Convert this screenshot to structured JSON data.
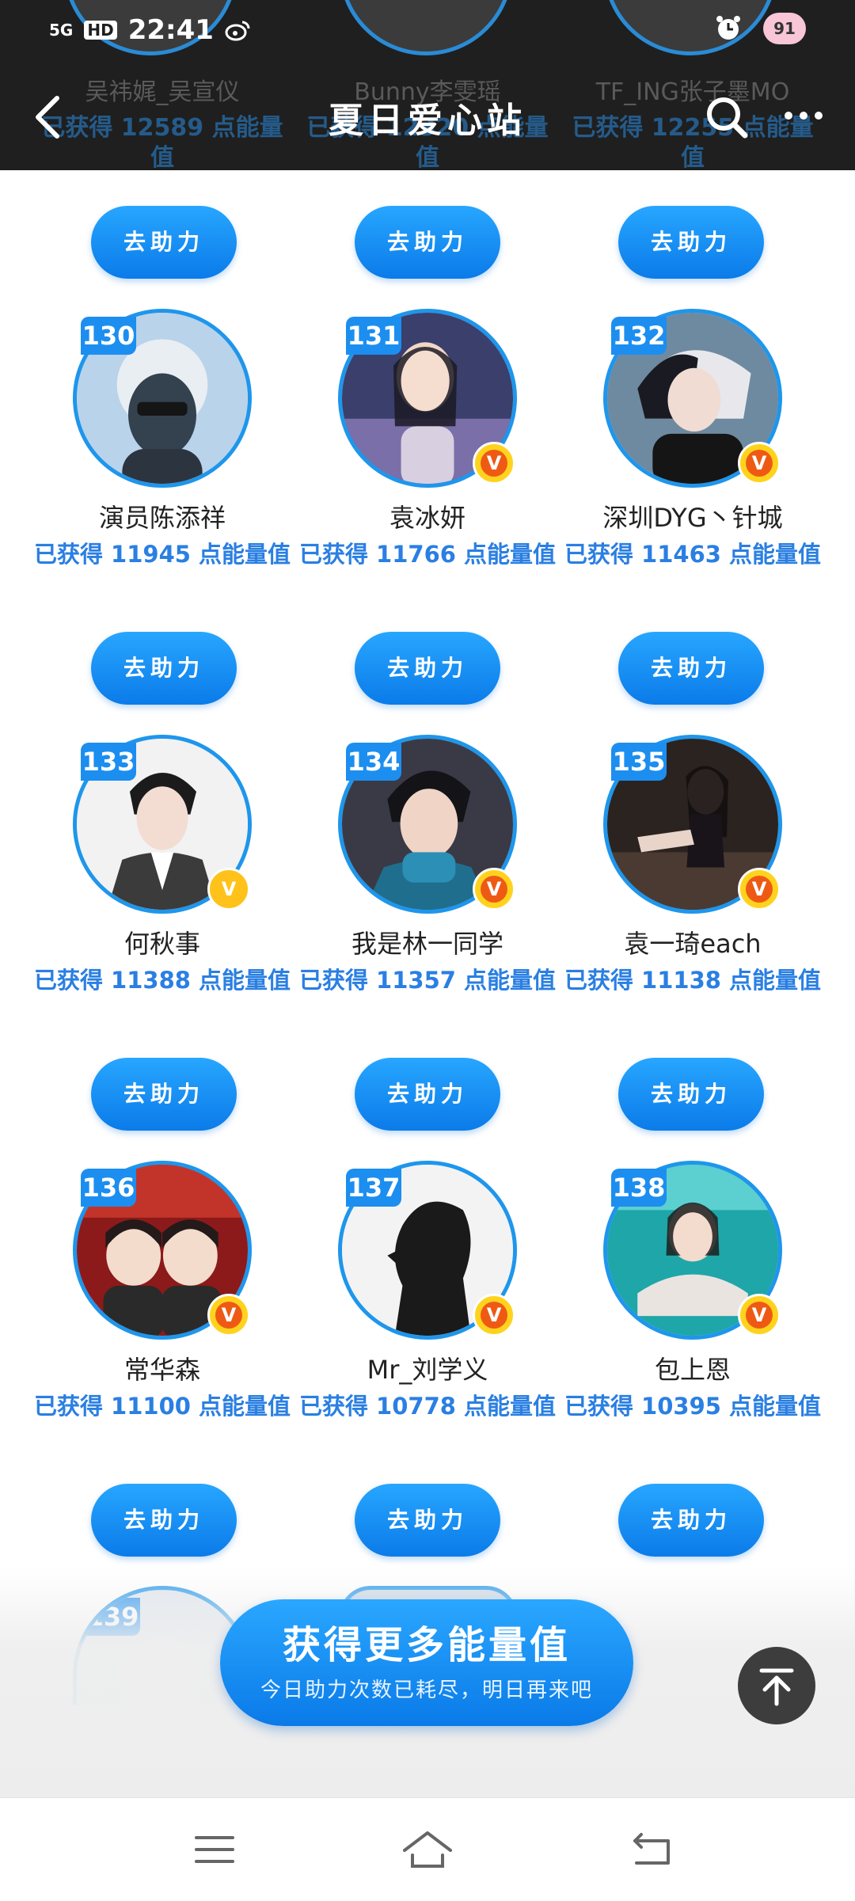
{
  "status_bar": {
    "network": "5G",
    "hd": "HD",
    "time": "22:41",
    "battery": "91"
  },
  "header": {
    "title": "夏日爱心站",
    "back_icon": "chevron-left-icon",
    "search_icon": "search-icon",
    "more_icon": "more-dots-icon"
  },
  "partial_top_row": [
    {
      "name": "吴祎娓_吴宣仪",
      "score_text": "已获得 12589 点能量值"
    },
    {
      "name": "Bunny李雯瑶",
      "score_text": "已获得 12320 点能量值"
    },
    {
      "name": "TF_ING张子墨MO",
      "score_text": "已获得 12255 点能量值"
    }
  ],
  "help_button_label": "去助力",
  "cards": [
    {
      "rank": "130",
      "name": "演员陈添祥",
      "score_text": "已获得 11945 点能量值",
      "verified": "none"
    },
    {
      "rank": "131",
      "name": "袁冰妍",
      "score_text": "已获得 11766 点能量值",
      "verified": "orange"
    },
    {
      "rank": "132",
      "name": "深圳DYG丶针城",
      "score_text": "已获得 11463 点能量值",
      "verified": "orange"
    },
    {
      "rank": "133",
      "name": "何秋事",
      "score_text": "已获得 11388 点能量值",
      "verified": "gold"
    },
    {
      "rank": "134",
      "name": "我是林一同学",
      "score_text": "已获得 11357 点能量值",
      "verified": "orange"
    },
    {
      "rank": "135",
      "name": "袁一琦each",
      "score_text": "已获得 11138 点能量值",
      "verified": "orange"
    },
    {
      "rank": "136",
      "name": "常华森",
      "score_text": "已获得 11100 点能量值",
      "verified": "orange"
    },
    {
      "rank": "137",
      "name": "Mr_刘学义",
      "score_text": "已获得 10778 点能量值",
      "verified": "orange"
    },
    {
      "rank": "138",
      "name": "包上恩",
      "score_text": "已获得 10395 点能量值",
      "verified": "orange"
    }
  ],
  "peek": {
    "rank": "139"
  },
  "cta": {
    "title": "获得更多能量值",
    "subtitle": "今日助力次数已耗尽，明日再来吧"
  },
  "colors": {
    "accent": "#1e96ec",
    "score_text": "#2a7fe2",
    "header_bg": "#1f1f1f",
    "verified_orange": "#ee5a14",
    "verified_gold": "#ffc21a"
  },
  "system_nav": {
    "menu_icon": "menu-icon",
    "home_icon": "home-icon",
    "back_icon": "back-icon"
  }
}
